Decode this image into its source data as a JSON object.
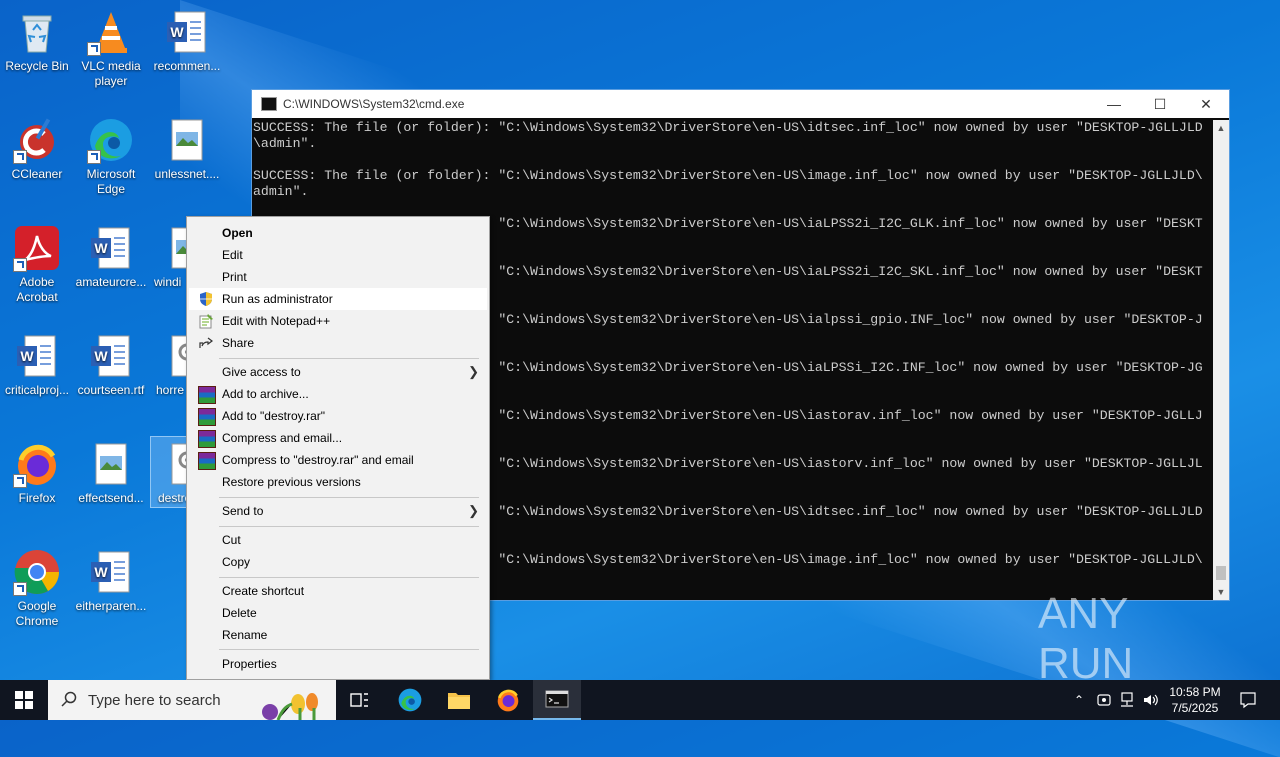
{
  "desktop": {
    "icons": [
      {
        "label": "Recycle Bin",
        "icon": "recycle-bin-icon"
      },
      {
        "label": "VLC media player",
        "icon": "vlc-icon"
      },
      {
        "label": "recommen...",
        "icon": "word-document-icon"
      },
      {
        "label": "CCleaner",
        "icon": "ccleaner-icon"
      },
      {
        "label": "Microsoft Edge",
        "icon": "edge-icon"
      },
      {
        "label": "unlessnet....",
        "icon": "image-file-icon"
      },
      {
        "label": "Adobe Acrobat",
        "icon": "acrobat-icon"
      },
      {
        "label": "amateurcre...",
        "icon": "word-document-icon"
      },
      {
        "label": "windi",
        "icon": "image-file-icon"
      },
      {
        "label": "criticalproj...",
        "icon": "word-document-icon"
      },
      {
        "label": "courtseen.rtf",
        "icon": "word-document-icon"
      },
      {
        "label": "horre",
        "icon": "gear-file-icon"
      },
      {
        "label": "Firefox",
        "icon": "firefox-icon"
      },
      {
        "label": "effectsend...",
        "icon": "image-file-icon"
      },
      {
        "label": "destro",
        "icon": "gear-file-icon"
      },
      {
        "label": "Google Chrome",
        "icon": "chrome-icon"
      },
      {
        "label": "eitherparen...",
        "icon": "word-document-icon"
      }
    ]
  },
  "cmd": {
    "title": "C:\\WINDOWS\\System32\\cmd.exe",
    "lines": [
      "SUCCESS: The file (or folder): \"C:\\Windows\\System32\\DriverStore\\en-US\\idtsec.inf_loc\" now owned by user \"DESKTOP-JGLLJLD",
      "\\admin\".",
      "",
      "SUCCESS: The file (or folder): \"C:\\Windows\\System32\\DriverStore\\en-US\\image.inf_loc\" now owned by user \"DESKTOP-JGLLJLD\\",
      "admin\".",
      "",
      "                               \"C:\\Windows\\System32\\DriverStore\\en-US\\iaLPSS2i_I2C_GLK.inf_loc\" now owned by user \"DESKT",
      "",
      "",
      "                               \"C:\\Windows\\System32\\DriverStore\\en-US\\iaLPSS2i_I2C_SKL.inf_loc\" now owned by user \"DESKT",
      "",
      "",
      "                               \"C:\\Windows\\System32\\DriverStore\\en-US\\ialpssi_gpio.INF_loc\" now owned by user \"DESKTOP-J",
      "",
      "",
      "                               \"C:\\Windows\\System32\\DriverStore\\en-US\\iaLPSSi_I2C.INF_loc\" now owned by user \"DESKTOP-JG",
      "",
      "",
      "                               \"C:\\Windows\\System32\\DriverStore\\en-US\\iastorav.inf_loc\" now owned by user \"DESKTOP-JGLLJ",
      "",
      "",
      "                               \"C:\\Windows\\System32\\DriverStore\\en-US\\iastorv.inf_loc\" now owned by user \"DESKTOP-JGLLJL",
      "",
      "",
      "                               \"C:\\Windows\\System32\\DriverStore\\en-US\\idtsec.inf_loc\" now owned by user \"DESKTOP-JGLLJLD",
      "",
      "",
      "                               \"C:\\Windows\\System32\\DriverStore\\en-US\\image.inf_loc\" now owned by user \"DESKTOP-JGLLJLD\\"
    ]
  },
  "context_menu": {
    "items": [
      {
        "label": "Open"
      },
      {
        "label": "Edit"
      },
      {
        "label": "Print"
      },
      {
        "label": "Run as administrator",
        "icon": "shield-icon"
      },
      {
        "label": "Edit with Notepad++",
        "icon": "notepadpp-icon"
      },
      {
        "label": "Share",
        "icon": "share-icon"
      },
      {
        "label": "Give access to"
      },
      {
        "label": "Add to archive...",
        "icon": "winrar-icon"
      },
      {
        "label": "Add to \"destroy.rar\"",
        "icon": "winrar-icon"
      },
      {
        "label": "Compress and email...",
        "icon": "winrar-icon"
      },
      {
        "label": "Compress to \"destroy.rar\" and email",
        "icon": "winrar-icon"
      },
      {
        "label": "Restore previous versions"
      },
      {
        "label": "Send to"
      },
      {
        "label": "Cut"
      },
      {
        "label": "Copy"
      },
      {
        "label": "Create shortcut"
      },
      {
        "label": "Delete"
      },
      {
        "label": "Rename"
      },
      {
        "label": "Properties"
      }
    ]
  },
  "taskbar": {
    "search_placeholder": "Type here to search",
    "time": "10:58 PM",
    "date": "7/5/2025"
  },
  "watermark": "ANY RUN"
}
